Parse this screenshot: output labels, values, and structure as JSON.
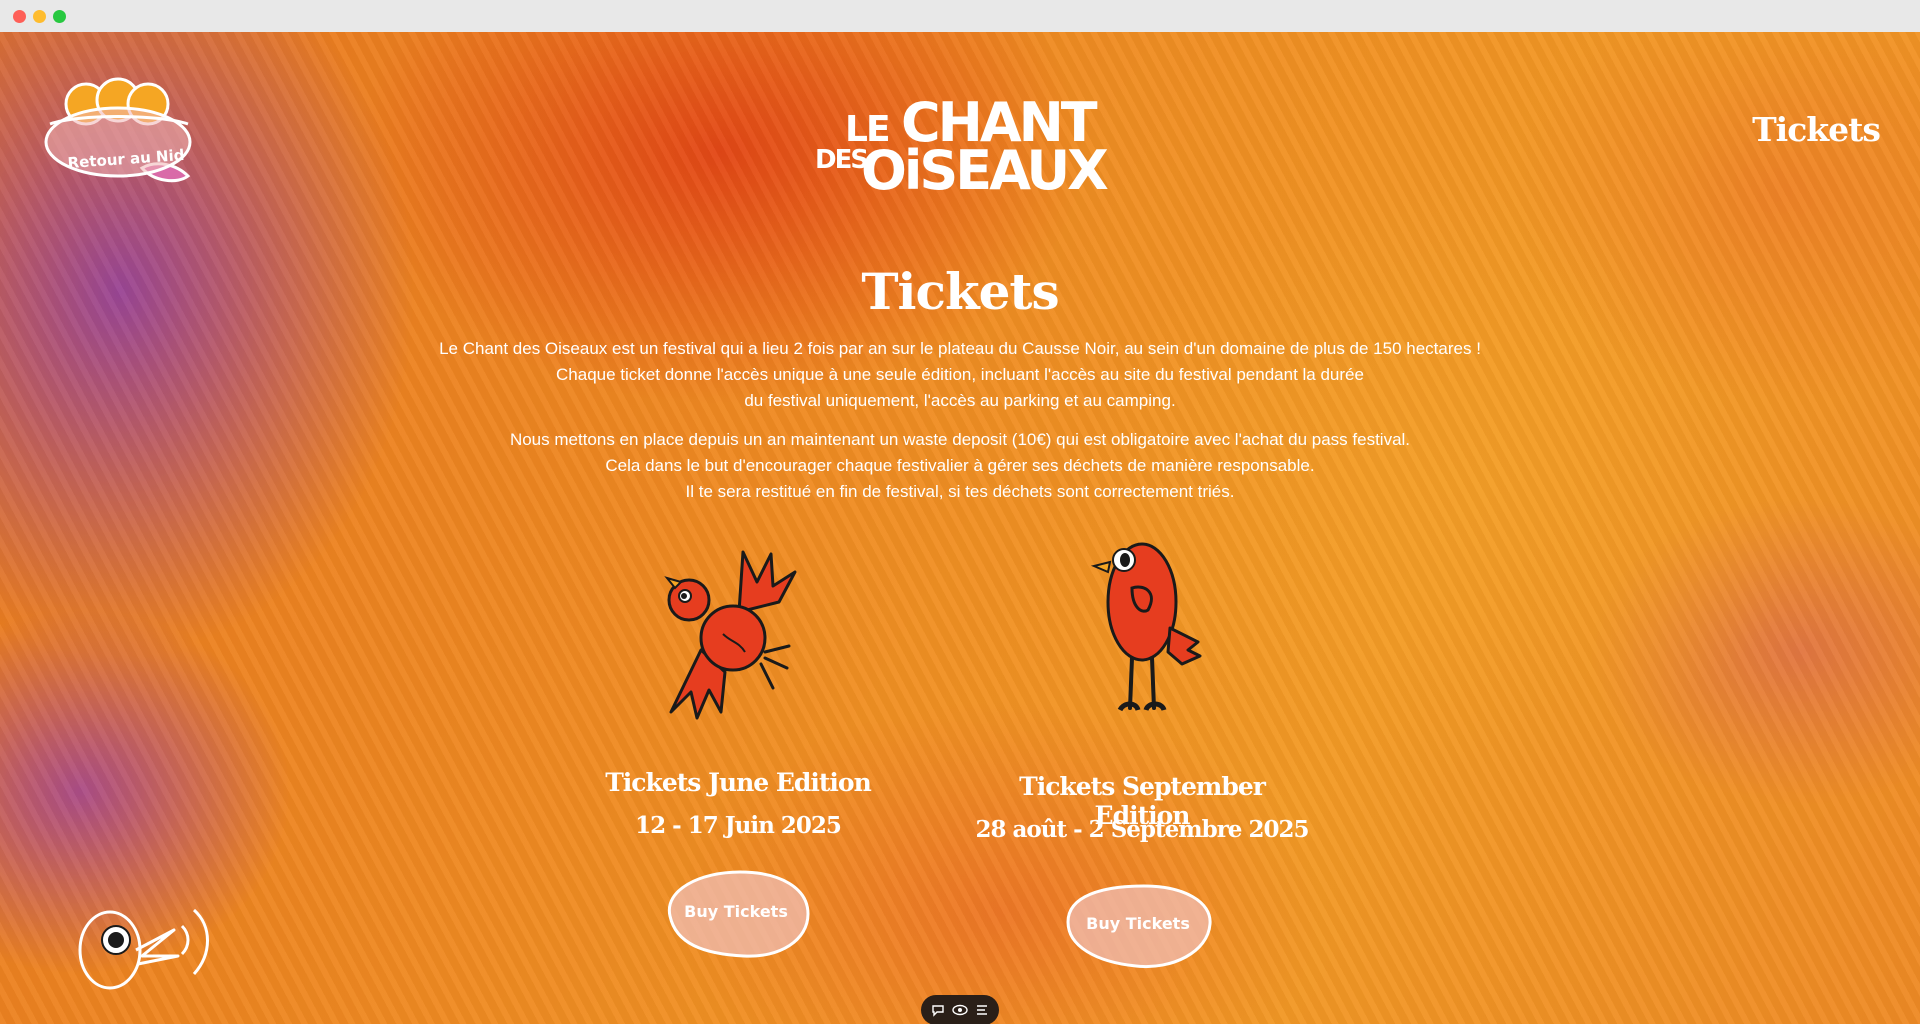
{
  "window": {
    "controls": [
      "close",
      "minimize",
      "maximize"
    ]
  },
  "colors": {
    "accent_red": "#e63d1f",
    "text": "#ffffff",
    "purple": "#8c3caa",
    "orange": "#ef8a22"
  },
  "nav": {
    "home_label": "Retour au Nid",
    "logo": {
      "line1_small": "LE",
      "line1_big": "CHANT",
      "line2_small": "DES",
      "line2_big": "OiSEAUX"
    },
    "tickets_link": "Tickets"
  },
  "main": {
    "title": "Tickets",
    "intro_paragraphs": [
      {
        "lines": [
          "Le Chant des Oiseaux est un festival qui a lieu 2 fois par an sur le plateau du Causse Noir, au sein d'un domaine de plus de 150 hectares !",
          "Chaque ticket donne l'accès unique à une seule édition, incluant l'accès au site du festival pendant la durée",
          "du festival uniquement, l'accès au parking et au camping."
        ]
      },
      {
        "lines": [
          "Nous mettons en place depuis un an maintenant un waste deposit (10€) qui est obligatoire avec l'achat du pass festival.",
          "Cela dans le but d'encourager chaque festivalier à gérer ses déchets de manière responsable.",
          "Il te sera restitué en fin de festival, si tes déchets sont correctement triés."
        ]
      }
    ],
    "tickets": [
      {
        "title": "Tickets June Edition",
        "dates": "12 - 17 Juin 2025",
        "button": "Buy Tickets",
        "icon": "flying-bird-icon"
      },
      {
        "title": "Tickets September Edition",
        "dates": "28 août - 2 Septembre 2025",
        "button": "Buy Tickets",
        "icon": "standing-bird-icon"
      }
    ]
  },
  "footer": {
    "sound_icon": "shouting-bird-icon",
    "toolbar_icons": [
      "comment-icon",
      "eye-icon",
      "list-icon"
    ]
  }
}
